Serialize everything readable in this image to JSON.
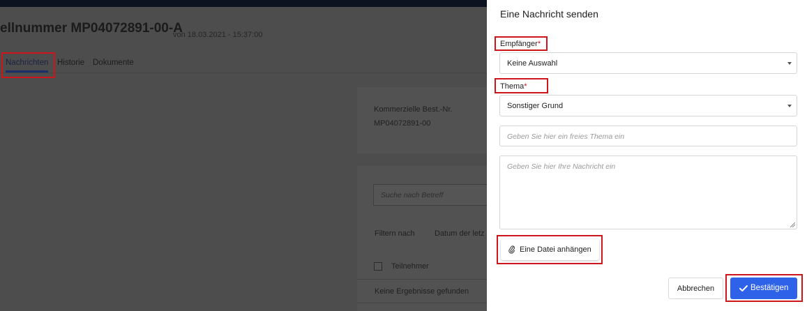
{
  "background": {
    "title": "ellnummer MP04072891-00-A",
    "title_date": "von 18.03.2021 - 15:37:00",
    "tabs": [
      {
        "label": "Nachrichten",
        "active": true
      },
      {
        "label": "Historie",
        "active": false
      },
      {
        "label": "Dokumente",
        "active": false
      }
    ],
    "card": {
      "label": "Kommerzielle Best.-Nr.",
      "value": "MP04072891-00"
    },
    "search_placeholder": "Suche nach Betreff",
    "filter_label": "Filtern nach",
    "filter_value": "Datum der letz",
    "participants_label": "Teilnehmer",
    "no_results": "Keine Ergebnisse gefunden"
  },
  "panel": {
    "title": "Eine Nachricht senden",
    "recipient": {
      "label": "Empfänger",
      "required_mark": "*",
      "value": "Keine Auswahl"
    },
    "topic": {
      "label": "Thema",
      "required_mark": "*",
      "value": "Sonstiger Grund"
    },
    "free_topic_placeholder": "Geben Sie hier ein freies Thema ein",
    "message_placeholder": "Geben Sie hier Ihre Nachricht ein",
    "attach_label": "Eine Datei anhängen",
    "cancel_label": "Abbrechen",
    "confirm_label": "Bestätigen"
  },
  "colors": {
    "highlight": "#d0141c",
    "primary_button": "#2e62e8",
    "required": "#c0121a",
    "overlay": "#4d4d4d"
  },
  "icons": {
    "attach": "paperclip-icon",
    "confirm": "checkmark-icon",
    "select": "caret-down-icon"
  }
}
